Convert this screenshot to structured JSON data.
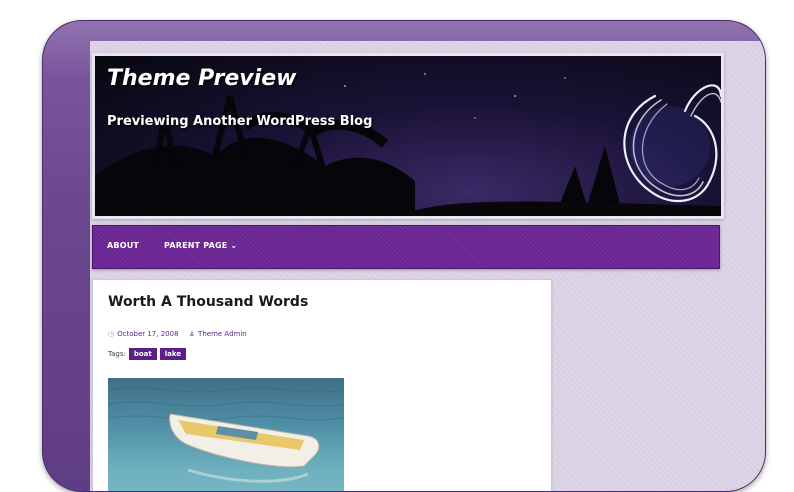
{
  "site": {
    "title": "Theme Preview",
    "description": "Previewing Another WordPress Blog"
  },
  "nav": {
    "items": [
      {
        "label": "ABOUT"
      },
      {
        "label": "PARENT PAGE ⌄"
      }
    ]
  },
  "post": {
    "title": "Worth A Thousand Words",
    "date": "October 17, 2008",
    "author": "Theme Admin",
    "tags_label": "Tags:",
    "tags": [
      "boat",
      "lake"
    ],
    "date_icon": "clock-icon",
    "author_icon": "user-icon"
  },
  "colors": {
    "accent": "#6a2592",
    "background": "#d9d1e3",
    "frame": "#6b4790"
  }
}
